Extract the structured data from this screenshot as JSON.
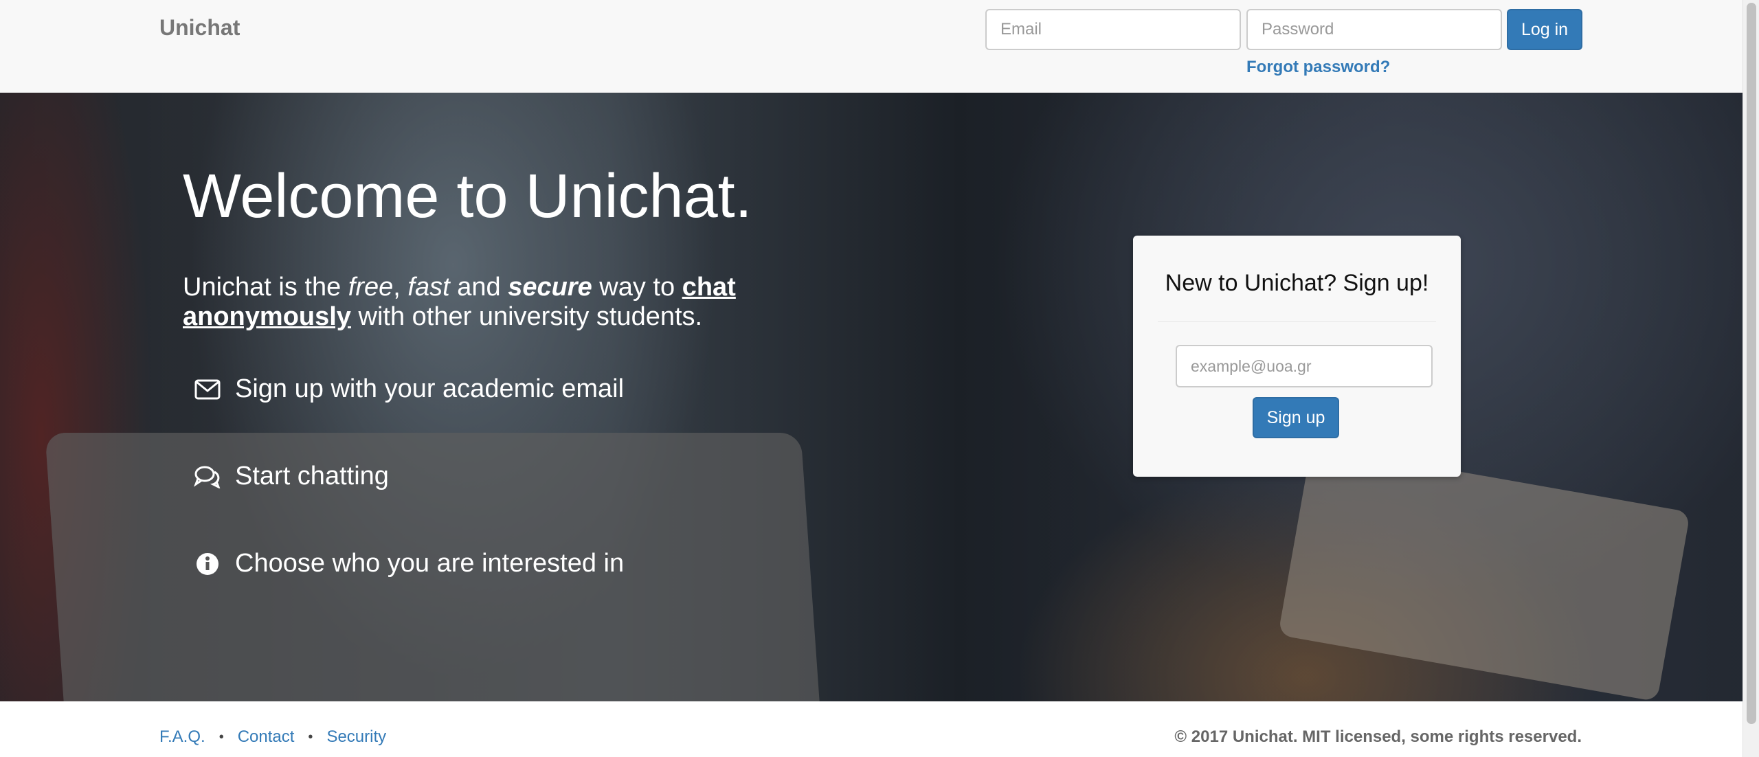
{
  "navbar": {
    "brand": "Unichat",
    "email_placeholder": "Email",
    "password_placeholder": "Password",
    "login_label": "Log in",
    "forgot_password": "Forgot password?"
  },
  "hero": {
    "title": "Welcome to Unichat.",
    "tagline": {
      "p1": "Unichat is the ",
      "free": "free",
      "comma": ", ",
      "fast": "fast",
      "and": " and ",
      "secure": "secure",
      "way_to": " way to ",
      "chat_anonymously": "chat anonymously",
      "rest": " with other university students."
    },
    "features": [
      {
        "icon": "envelope-icon",
        "label": "Sign up with your academic email"
      },
      {
        "icon": "chat-bubbles-icon",
        "label": "Start chatting"
      },
      {
        "icon": "info-icon",
        "label": "Choose who you are interested in"
      }
    ]
  },
  "signup_card": {
    "title": "New to Unichat? Sign up!",
    "email_placeholder": "example@uoa.gr",
    "button_label": "Sign up"
  },
  "footer": {
    "links": [
      "F.A.Q.",
      "Contact",
      "Security"
    ],
    "separator": "•",
    "copyright": "© 2017 Unichat. MIT licensed, some rights reserved."
  },
  "colors": {
    "accent": "#337ab7",
    "navbar_bg": "#f8f8f8",
    "brand_text": "#777777"
  }
}
